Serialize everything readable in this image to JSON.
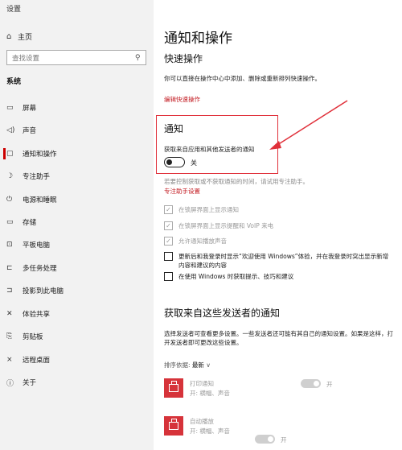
{
  "window": {
    "title": "设置"
  },
  "sidebar": {
    "home_label": "主页",
    "search_placeholder": "查找设置",
    "section": "系统",
    "items": [
      {
        "label": "屏幕",
        "icon": "monitor-icon"
      },
      {
        "label": "声音",
        "icon": "speaker-icon"
      },
      {
        "label": "通知和操作",
        "icon": "notification-icon",
        "active": true
      },
      {
        "label": "专注助手",
        "icon": "moon-icon"
      },
      {
        "label": "电源和睡眠",
        "icon": "power-icon"
      },
      {
        "label": "存储",
        "icon": "storage-icon"
      },
      {
        "label": "平板电脑",
        "icon": "tablet-icon"
      },
      {
        "label": "多任务处理",
        "icon": "multitask-icon"
      },
      {
        "label": "投影到此电脑",
        "icon": "project-icon"
      },
      {
        "label": "体验共享",
        "icon": "share-icon"
      },
      {
        "label": "剪贴板",
        "icon": "clipboard-icon"
      },
      {
        "label": "远程桌面",
        "icon": "remote-icon"
      },
      {
        "label": "关于",
        "icon": "info-icon"
      }
    ]
  },
  "main": {
    "page_title": "通知和操作",
    "quick_actions": {
      "title": "快速操作",
      "desc": "你可以直接在操作中心中添加、删除或重新排列快速操作。",
      "edit_link": "编辑快速操作"
    },
    "notifications": {
      "title": "通知",
      "label": "获取来自应用和其他发送者的通知",
      "toggle_state": "关",
      "focus_desc": "若要控制获取或不获取通知的时间，请试用专注助手。",
      "focus_link": "专注助手设置",
      "checkboxes": [
        {
          "label": "在锁屏界面上显示通知",
          "checked": true,
          "disabled": true
        },
        {
          "label": "在锁屏界面上显示提醒和 VoIP 来电",
          "checked": true,
          "disabled": true
        },
        {
          "label": "允许通知播放声音",
          "checked": true,
          "disabled": true
        },
        {
          "label": "更新后和我登录时显示“欢迎使用 Windows”体验，并在我登录时突出显示新增内容和建议的内容",
          "checked": false,
          "disabled": false
        },
        {
          "label": "在使用 Windows 时获取提示、技巧和建议",
          "checked": false,
          "disabled": false
        }
      ]
    },
    "senders": {
      "title": "获取来自这些发送者的通知",
      "desc": "选择发送者可查看更多设置。一些发送者还可能有其自己的通知设置。如果是这样，打开发送者即可更改这些设置。",
      "sort_label": "排序依据:",
      "sort_value": "最新",
      "apps": [
        {
          "name": "打印通知",
          "sub": "开: 横幅、声音",
          "state": "开"
        },
        {
          "name": "自动播放",
          "sub": "开: 横幅、声音",
          "state": "开"
        }
      ]
    }
  }
}
